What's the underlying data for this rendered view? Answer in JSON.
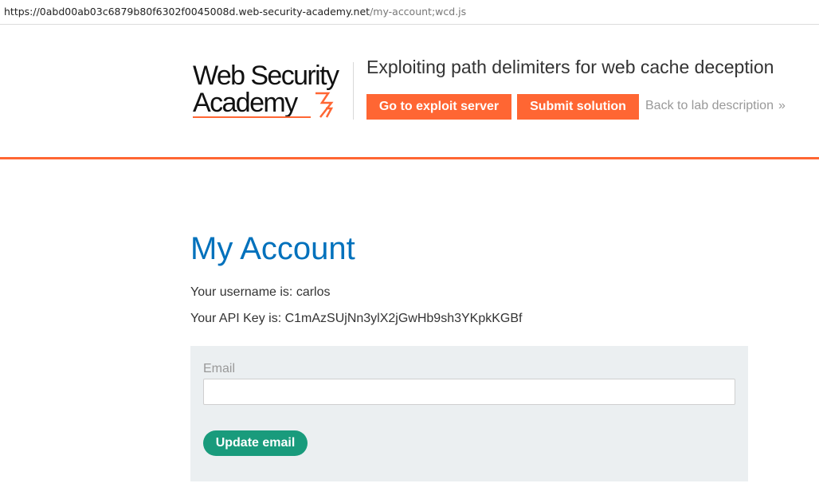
{
  "browser": {
    "url_host": "https://0abd00ab03c6879b80f6302f0045008d.web-security-academy.net",
    "url_path": "/my-account;wcd.js"
  },
  "header": {
    "logo_line1": "Web Security",
    "logo_line2": "Academy",
    "lab_title": "Exploiting path delimiters for web cache deception",
    "exploit_button": "Go to exploit server",
    "submit_button": "Submit solution",
    "back_link": "Back to lab description",
    "back_chevron": "»"
  },
  "account": {
    "title": "My Account",
    "username_line": "Your username is: carlos",
    "api_key_line": "Your API Key is: C1mAzSUjNn3ylX2jGwHb9sh3YKpkKGBf"
  },
  "email_form": {
    "label": "Email",
    "value": "",
    "placeholder": "",
    "button": "Update email"
  },
  "colors": {
    "brand_orange": "#ff6633",
    "title_blue": "#0071bc",
    "button_green": "#199b7c",
    "panel_bg": "#ebeff1"
  }
}
